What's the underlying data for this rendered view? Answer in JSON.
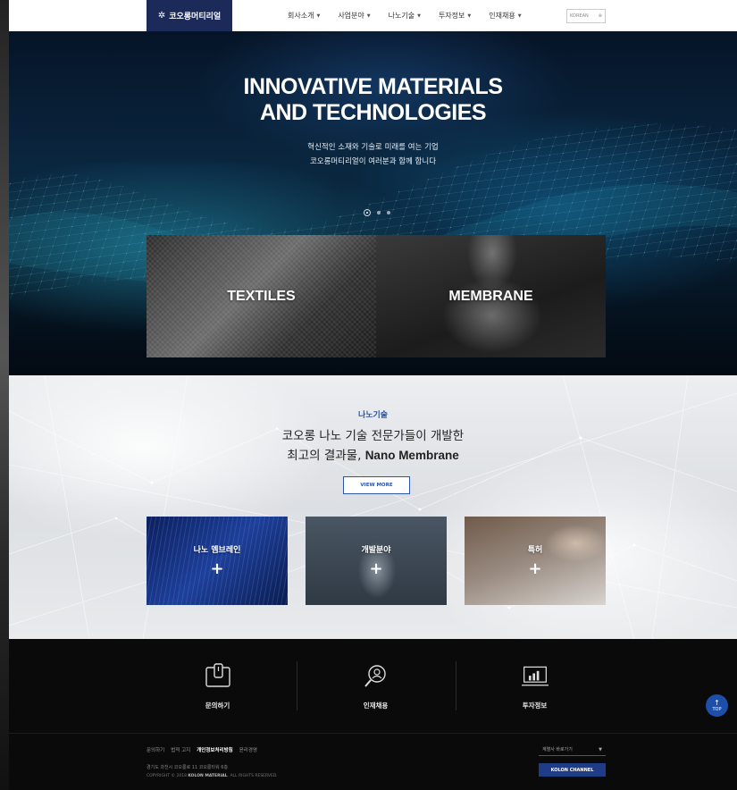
{
  "header": {
    "logo_text": "코오롱머티리얼",
    "nav": [
      {
        "label": "회사소개"
      },
      {
        "label": "사업분야"
      },
      {
        "label": "나노기술"
      },
      {
        "label": "투자정보"
      },
      {
        "label": "인재채용"
      }
    ],
    "language": "KOREAN"
  },
  "hero": {
    "title_line1": "INNOVATIVE MATERIALS",
    "title_line2": "AND TECHNOLOGIES",
    "sub_line1": "혁신적인 소재와 기술로 미래를 여는 기업",
    "sub_line2": "코오롱머티리얼이 여러분과 함께 합니다",
    "slides": {
      "count": 3,
      "active": 1
    },
    "cards": [
      {
        "label": "TEXTILES"
      },
      {
        "label": "MEMBRANE"
      }
    ]
  },
  "nano": {
    "kicker": "나노기술",
    "headline_line1": "코오롱 나노 기술 전문가들이 개발한",
    "headline_line2_prefix": "최고의 결과물, ",
    "headline_line2_bold": "Nano Membrane",
    "view_more": "VIEW MORE",
    "cards": [
      {
        "label": "나노 멤브레인",
        "plus": "+"
      },
      {
        "label": "개발분야",
        "plus": "+"
      },
      {
        "label": "특허",
        "plus": "+"
      }
    ]
  },
  "quick_links": [
    {
      "label": "문의하기",
      "icon": "inquiry-icon"
    },
    {
      "label": "인재채용",
      "icon": "recruit-icon"
    },
    {
      "label": "투자정보",
      "icon": "investment-icon"
    }
  ],
  "top_button": "TOP",
  "footer": {
    "links": [
      "문의하기",
      "법적 고지",
      "개인정보처리방침",
      "윤리경영"
    ],
    "address": "경기도 과천시 코오롱로 11 코오롱타워 6층",
    "copyright_prefix": "COPYRIGHT © 2018 ",
    "copyright_brand": "KOLON MATERIAL",
    "copyright_suffix": ". ALL RIGHTS RESERVED.",
    "family_site": "계열사 바로가기",
    "channel": "KOLON CHANNEL"
  },
  "colors": {
    "brand_navy": "#1c2a5a",
    "accent_blue": "#2a56a8",
    "top_button": "#1e4fa8"
  }
}
